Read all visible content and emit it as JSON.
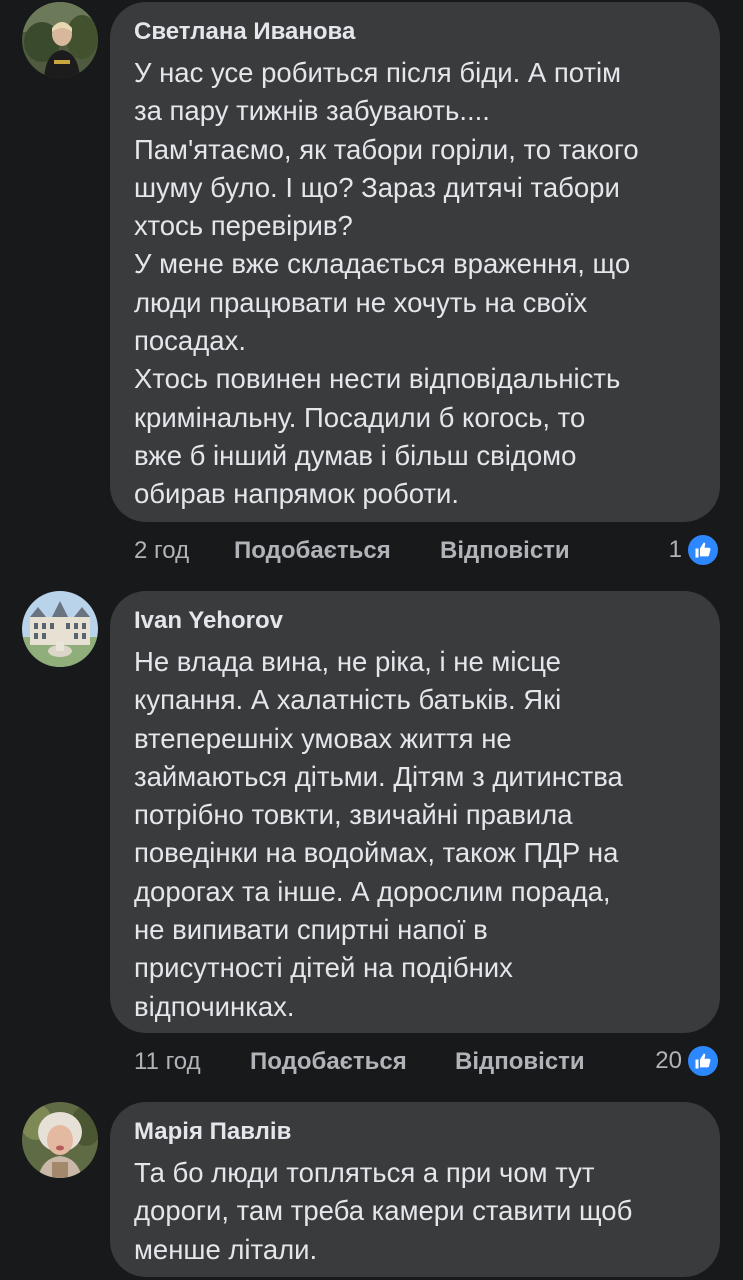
{
  "comments": [
    {
      "author": "Светлана Иванова",
      "lines": [
        "У нас усе робиться після біди. А потім",
        "за пару тижнів забувають....",
        "Пам'ятаємо, як табори горіли, то такого",
        "шуму було. І що? Зараз дитячі табори",
        "хтось перевірив?",
        "У мене вже складається враження, що",
        "люди працювати не хочуть на своїх",
        "посадах.",
        "Хтось повинен нести відповідальність",
        "кримінальну. Посадили б когось, то",
        "вже б інший думав і більш свідомо",
        "обирав напрямок роботи."
      ],
      "time": "2 год",
      "like_label": "Подобається",
      "reply_label": "Відповісти",
      "reaction_count": "1",
      "reaction_icon": "thumbs-up-icon"
    },
    {
      "author": "Ivan Yehorov",
      "lines": [
        "Не влада вина, не ріка, і не місце",
        "купання. А халатність батьків. Які",
        "втеперешніх умовах життя не",
        "займаються дітьми. Дітям з дитинства",
        "потрібно товкти, звичайні правила",
        "поведінки на водоймах, також ПДР на",
        "дорогах та інше. А дорослим порада,",
        "не випивати спиртні напої в",
        "присутності дітей на подібних",
        "відпочинках."
      ],
      "time": "11 год",
      "like_label": "Подобається",
      "reply_label": "Відповісти",
      "reaction_count": "20",
      "reaction_icon": "thumbs-up-icon"
    },
    {
      "author": "Марія Павлів",
      "lines": [
        "Та бо люди топляться а при чом тут",
        "дороги, там треба камери ставити щоб",
        "менше літали."
      ]
    }
  ],
  "colors": {
    "background": "#18191a",
    "bubble": "#3a3b3c",
    "text": "#e4e6eb",
    "secondary_text": "#b0b3b8",
    "reaction_blue": "#2d88ff"
  }
}
